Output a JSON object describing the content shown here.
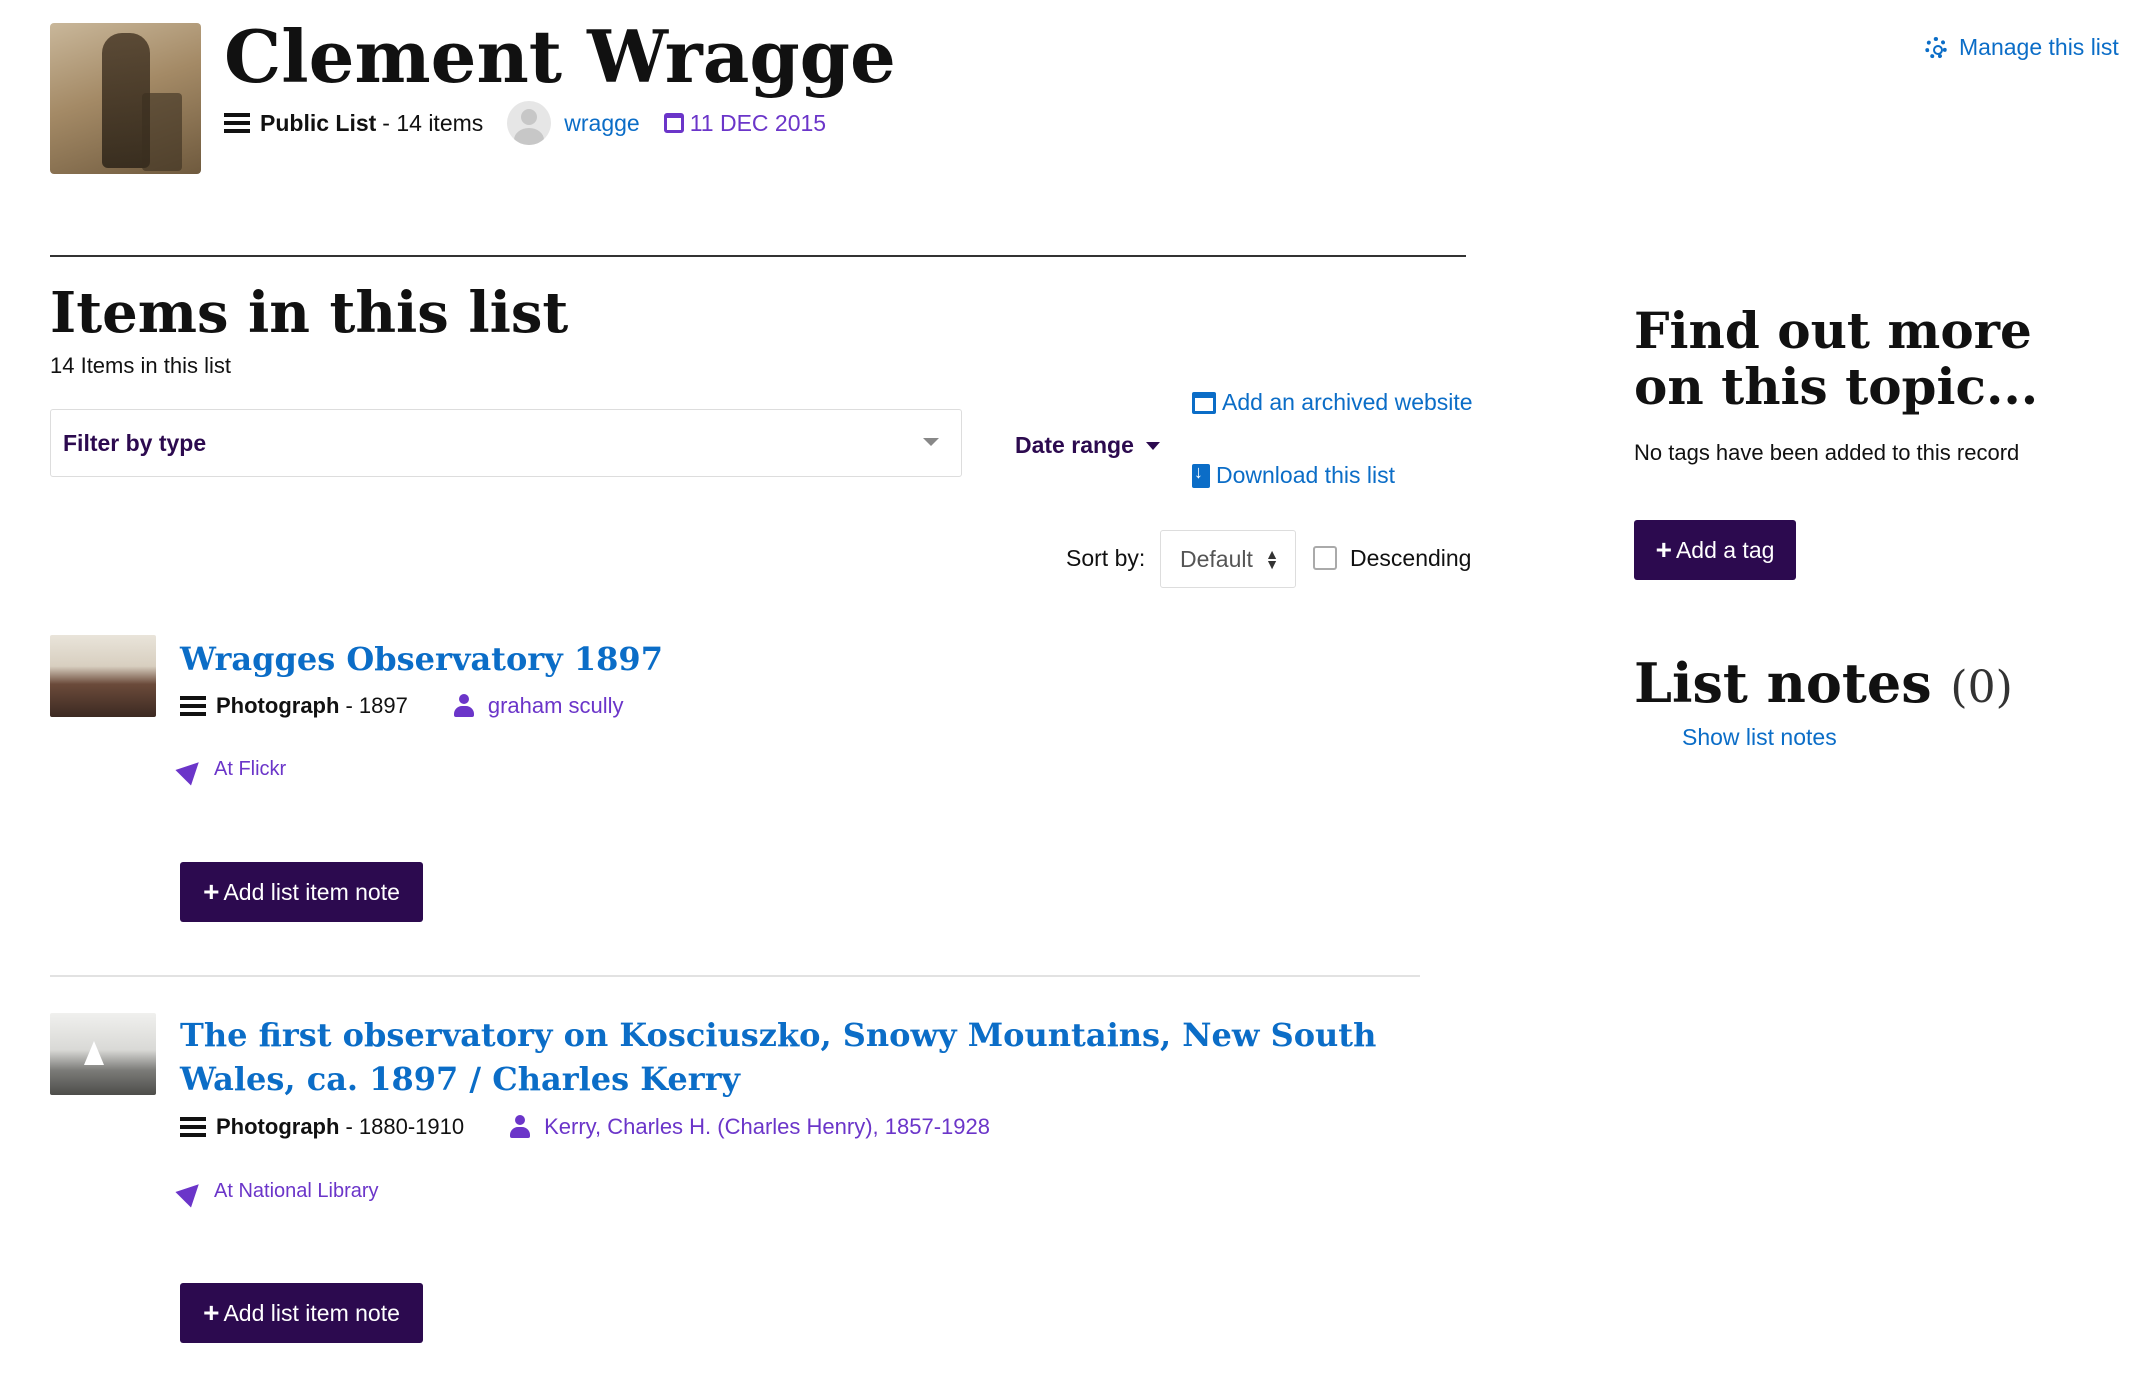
{
  "header": {
    "title": "Clement Wragge",
    "list_type": "Public List",
    "item_count_text": "- 14 items",
    "owner": "wragge",
    "date": "11 DEC 2015",
    "manage_label": "Manage this list"
  },
  "items_section": {
    "heading": "Items in this list",
    "count_text": "14 Items in this list",
    "filter_label": "Filter by type",
    "date_range_label": "Date range",
    "add_archived_label": "Add an archived website",
    "download_label": "Download this list",
    "sort_label": "Sort by:",
    "sort_value": "Default",
    "descending_label": "Descending"
  },
  "items": [
    {
      "title": "Wragges Observatory 1897",
      "format": "Photograph",
      "date": "- 1897",
      "creator": "graham scully",
      "location": "At Flickr",
      "note_button": "Add list item note"
    },
    {
      "title": "The first observatory on Kosciuszko, Snowy Mountains, New South Wales, ca. 1897 / Charles Kerry",
      "format": "Photograph",
      "date": "- 1880-1910",
      "creator": "Kerry, Charles H. (Charles Henry), 1857-1928",
      "location": "At National Library",
      "note_button": "Add list item note"
    }
  ],
  "sidebar": {
    "find_more_heading": "Find out more on this topic...",
    "no_tags_text": "No tags have been added to this record",
    "add_tag_label": "Add a tag",
    "notes_heading": "List notes",
    "notes_count": "(0)",
    "show_notes_label": "Show list notes"
  },
  "colors": {
    "link": "#0b6dc7",
    "accent_purple": "#6b35c9",
    "button_bg": "#2c0a4f"
  },
  "icons": [
    "list-icon",
    "avatar-icon",
    "calendar-icon",
    "gear-icon",
    "browser-icon",
    "download-icon",
    "person-icon",
    "location-arrow-icon",
    "plus-icon"
  ]
}
